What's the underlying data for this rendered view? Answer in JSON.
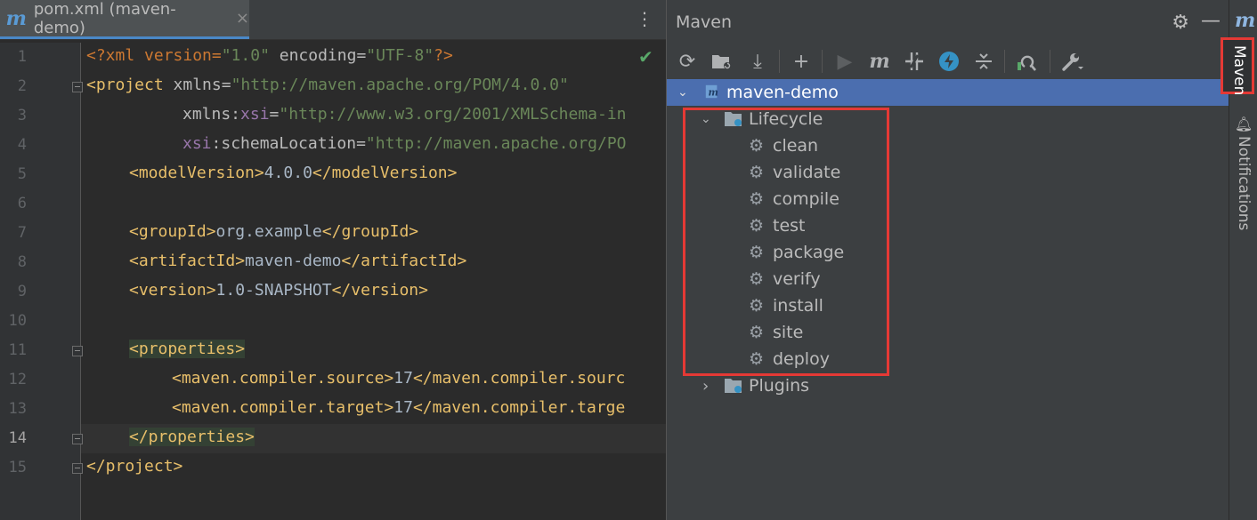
{
  "editor": {
    "tab_title": "pom.xml (maven-demo)",
    "tab_icon": "m",
    "close_glyph": "×",
    "menu_glyph": "⋮",
    "line_numbers": [
      "1",
      "2",
      "3",
      "4",
      "5",
      "6",
      "7",
      "8",
      "9",
      "10",
      "11",
      "12",
      "13",
      "14",
      "15"
    ],
    "lines": {
      "l1": {
        "a": "<?xml version=",
        "b": "\"1.0\"",
        "c": " encoding=",
        "d": "\"UTF-8\"",
        "e": "?>"
      },
      "l2": {
        "a": "<project",
        "b": " xmlns=",
        "c": "\"http://maven.apache.org/POM/4.0.0\""
      },
      "l3": {
        "a": "xmlns:",
        "b": "xsi",
        "c": "=",
        "d": "\"http://www.w3.org/2001/XMLSchema-in"
      },
      "l4": {
        "a": "xsi",
        "b": ":schemaLocation=",
        "c": "\"http://maven.apache.org/PO"
      },
      "l5": {
        "a": "<modelVersion>",
        "b": "4.0.0",
        "c": "</modelVersion>"
      },
      "l7": {
        "a": "<groupId>",
        "b": "org.example",
        "c": "</groupId>"
      },
      "l8": {
        "a": "<artifactId>",
        "b": "maven-demo",
        "c": "</artifactId>"
      },
      "l9": {
        "a": "<version>",
        "b": "1.0-SNAPSHOT",
        "c": "</version>"
      },
      "l11": {
        "a": "<properties>"
      },
      "l12": {
        "a": "<maven.compiler.source>",
        "b": "17",
        "c": "</maven.compiler.sourc"
      },
      "l13": {
        "a": "<maven.compiler.target>",
        "b": "17",
        "c": "</maven.compiler.targe"
      },
      "l14": {
        "a": "</properties>"
      },
      "l15": {
        "a": "</project>"
      }
    },
    "current_line": "14"
  },
  "maven": {
    "title": "Maven",
    "toolbar": [
      "refresh-icon",
      "reimport-folder-icon",
      "download-icon",
      "add-icon",
      "run-icon",
      "maven-goal-icon",
      "toggle-offline-icon",
      "skip-tests-icon",
      "collapse-icon",
      "analyze-dependencies-icon",
      "settings-wrench-icon"
    ],
    "project": "maven-demo",
    "lifecycle_label": "Lifecycle",
    "lifecycle": [
      "clean",
      "validate",
      "compile",
      "test",
      "package",
      "verify",
      "install",
      "site",
      "deploy"
    ],
    "plugins_label": "Plugins"
  },
  "sidebar": {
    "maven_tab": "Maven",
    "notifications_tab": "Notifications"
  },
  "colors": {
    "highlight_box": "#e53935",
    "selection": "#4b6eaf"
  }
}
